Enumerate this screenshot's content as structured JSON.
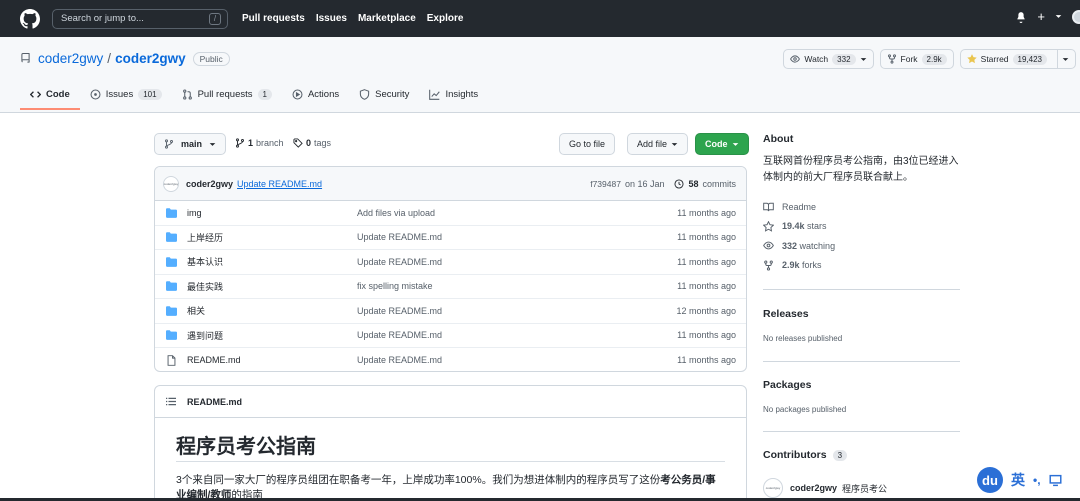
{
  "header": {
    "search_placeholder": "Search or jump to...",
    "slash_key": "/",
    "nav": [
      "Pull requests",
      "Issues",
      "Marketplace",
      "Explore"
    ],
    "plus": "+"
  },
  "repo": {
    "owner": "coder2gwy",
    "sep": "/",
    "name": "coder2gwy",
    "visibility": "Public",
    "watch_label": "Watch",
    "watch_count": "332",
    "fork_label": "Fork",
    "fork_count": "2.9k",
    "star_label": "Starred",
    "star_count": "19,423"
  },
  "tabs": [
    {
      "label": "Code",
      "count": ""
    },
    {
      "label": "Issues",
      "count": "101"
    },
    {
      "label": "Pull requests",
      "count": "1"
    },
    {
      "label": "Actions",
      "count": ""
    },
    {
      "label": "Security",
      "count": ""
    },
    {
      "label": "Insights",
      "count": ""
    }
  ],
  "branchbar": {
    "branch": "main",
    "branches_count": "1",
    "branches_label": "branch",
    "tags_count": "0",
    "tags_label": "tags",
    "goto": "Go to file",
    "add": "Add file",
    "code": "Code"
  },
  "commit": {
    "avatar_text": "coder2gwy",
    "author": "coder2gwy",
    "message": "Update README.md",
    "hash": "f739487",
    "date": "on 16 Jan",
    "count": "58",
    "count_label": "commits"
  },
  "files": [
    {
      "name": "img",
      "msg": "Add files via upload",
      "age": "11 months ago",
      "type": "dir"
    },
    {
      "name": "上岸经历",
      "msg": "Update README.md",
      "age": "11 months ago",
      "type": "dir"
    },
    {
      "name": "基本认识",
      "msg": "Update README.md",
      "age": "11 months ago",
      "type": "dir"
    },
    {
      "name": "最佳实践",
      "msg": "fix spelling mistake",
      "age": "11 months ago",
      "type": "dir"
    },
    {
      "name": "相关",
      "msg": "Update README.md",
      "age": "12 months ago",
      "type": "dir"
    },
    {
      "name": "遇到问题",
      "msg": "Update README.md",
      "age": "11 months ago",
      "type": "dir"
    },
    {
      "name": "README.md",
      "msg": "Update README.md",
      "age": "11 months ago",
      "type": "file"
    }
  ],
  "readme": {
    "filename": "README.md",
    "title": "程序员考公指南",
    "para_a": "3个来自同一家大厂的程序员组团在职备考一年，上岸成功率100%。我们为想进体制内的程序员写了这份",
    "para_b": "考公务员/事业编制/教师",
    "para_c": "的指南"
  },
  "about": {
    "heading": "About",
    "description": "互联网首份程序员考公指南，由3位已经进入体制内的前大厂程序员联合献上。",
    "readme_label": "Readme",
    "stars_count": "19.4k",
    "stars_label": "stars",
    "watching_count": "332",
    "watching_label": "watching",
    "forks_count": "2.9k",
    "forks_label": "forks"
  },
  "releases": {
    "heading": "Releases",
    "note": "No releases published"
  },
  "packages": {
    "heading": "Packages",
    "note": "No packages published"
  },
  "contributors": {
    "heading": "Contributors",
    "count": "3",
    "avatar_text": "coder2gwy",
    "name": "coder2gwy",
    "subtitle": "程序员考公"
  },
  "ime": {
    "logo": "du",
    "lang": "英",
    "punct": "•,"
  }
}
